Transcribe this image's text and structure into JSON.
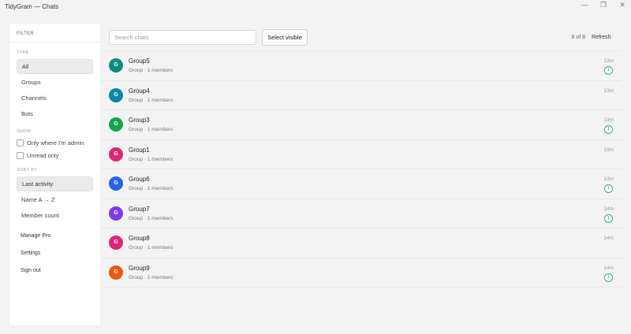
{
  "window": {
    "title": "TidyGram — Chats",
    "minimize_icon": "—",
    "maximize_icon": "❐",
    "close_icon": "✕"
  },
  "sidebar": {
    "filter_label": "FILTER",
    "type_label": "TYPE",
    "type_items": [
      {
        "label": "All",
        "active": true
      },
      {
        "label": "Groups",
        "active": false
      },
      {
        "label": "Channels",
        "active": false
      },
      {
        "label": "Bots",
        "active": false
      }
    ],
    "show_label": "SHOW",
    "show_options": [
      {
        "label": "Only where I'm admin",
        "checked": false
      },
      {
        "label": "Unread only",
        "checked": false
      }
    ],
    "sort_label": "SORT BY",
    "sort_items": [
      {
        "label": "Last activity",
        "active": true
      },
      {
        "label": "Name A → Z",
        "active": false
      },
      {
        "label": "Member count",
        "active": false
      }
    ],
    "links": [
      {
        "label": "Manage Pro"
      },
      {
        "label": "Settings"
      },
      {
        "label": "Sign out"
      }
    ]
  },
  "toolbar": {
    "search_placeholder": "Search chats",
    "select_visible_label": "Select visible",
    "count_text": "8 of 8",
    "refresh_label": "Refresh"
  },
  "chats": [
    {
      "initial": "G",
      "name": "Group5",
      "meta": "Group · 1 members",
      "time": "13m",
      "unread": "1",
      "color": "#0f8a7e"
    },
    {
      "initial": "G",
      "name": "Group4",
      "meta": "Group · 1 members",
      "time": "13m",
      "unread": "",
      "color": "#0e86a6"
    },
    {
      "initial": "G",
      "name": "Group3",
      "meta": "Group · 1 members",
      "time": "13m",
      "unread": "1",
      "color": "#16a34a"
    },
    {
      "initial": "G",
      "name": "Group1",
      "meta": "Group · 1 members",
      "time": "13m",
      "unread": "",
      "color": "#db2777"
    },
    {
      "initial": "G",
      "name": "Group6",
      "meta": "Group · 1 members",
      "time": "13m",
      "unread": "1",
      "color": "#2563eb"
    },
    {
      "initial": "G",
      "name": "Group7",
      "meta": "Group · 1 members",
      "time": "14m",
      "unread": "1",
      "color": "#7c3aed"
    },
    {
      "initial": "G",
      "name": "Group8",
      "meta": "Group · 1 members",
      "time": "14m",
      "unread": "",
      "color": "#db2777"
    },
    {
      "initial": "G",
      "name": "Group9",
      "meta": "Group · 1 members",
      "time": "14m",
      "unread": "1",
      "color": "#ea580c"
    }
  ]
}
